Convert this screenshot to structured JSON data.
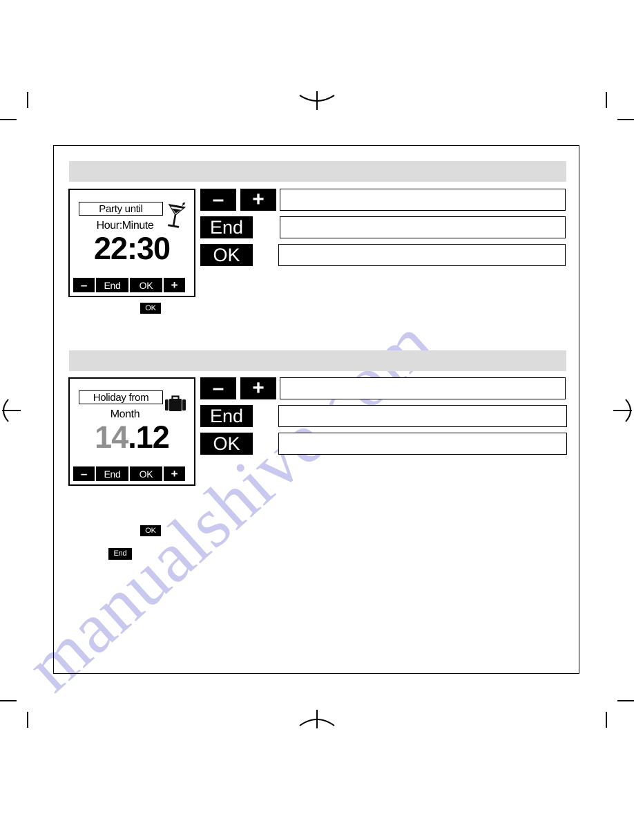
{
  "page": {
    "watermark_text": "manualshive.com",
    "background_color": "#ffffff",
    "frame_border_color": "#000000",
    "section_bar_color": "#dcdcdc"
  },
  "sections": [
    {
      "id": "party-until",
      "bar_label": "",
      "display": {
        "title": "Party until",
        "subtitle": "Hour:Minute",
        "value_primary": "22:30",
        "value_dim": "",
        "icon": "cocktail-glass-icon",
        "softkeys": [
          {
            "label": "–",
            "name": "minus"
          },
          {
            "label": "End",
            "name": "end"
          },
          {
            "label": "OK",
            "name": "ok"
          },
          {
            "label": "+",
            "name": "plus"
          }
        ]
      },
      "keys": [
        {
          "label": "–",
          "name": "minus-key"
        },
        {
          "label": "+",
          "name": "plus-key"
        },
        {
          "label": "End",
          "name": "end-key"
        },
        {
          "label": "OK",
          "name": "ok-key"
        }
      ],
      "text_boxes": [
        "",
        "",
        ""
      ],
      "chips": [
        {
          "label": "OK",
          "name": "ok-chip"
        }
      ]
    },
    {
      "id": "holiday-from",
      "bar_label": "",
      "display": {
        "title": "Holiday from",
        "subtitle": "Month",
        "value_dim": "14",
        "value_separator": ".",
        "value_primary": "12",
        "icon": "suitcase-icon",
        "softkeys": [
          {
            "label": "–",
            "name": "minus"
          },
          {
            "label": "End",
            "name": "end"
          },
          {
            "label": "OK",
            "name": "ok"
          },
          {
            "label": "+",
            "name": "plus"
          }
        ]
      },
      "keys": [
        {
          "label": "–",
          "name": "minus-key"
        },
        {
          "label": "+",
          "name": "plus-key"
        },
        {
          "label": "End",
          "name": "end-key"
        },
        {
          "label": "OK",
          "name": "ok-key"
        }
      ],
      "text_boxes": [
        "",
        "",
        ""
      ],
      "chips": [
        {
          "label": "OK",
          "name": "ok-chip"
        },
        {
          "label": "End",
          "name": "end-chip"
        }
      ]
    }
  ]
}
